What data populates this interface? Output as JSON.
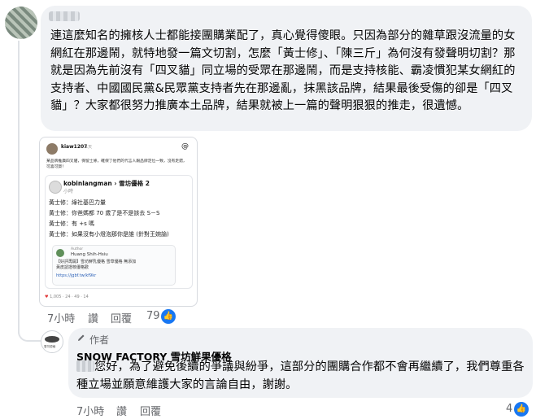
{
  "comment1": {
    "text": "連這麼知名的擁核人士都能接團購業配了，真心覺得傻眼。只因為部分的雜草跟沒流量的女網紅在那邊鬧，就特地發一篇文切割，怎麼「黃士修」、「陳三斤」為何沒有發聲明切割？那就是因為先前沒有「四叉貓」同立場的受眾在那邊鬧，而是支持核能、霸凌慣犯某女網紅的支持者、中國國民黨&民眾黨支持者先在那邊亂，抹黑該品牌，結果最後受傷的卻是「四叉貓」？大家都很努力推廣本土品牌，結果就被上一篇的聲明狠狠的推走，很遺憾。",
    "time": "7小時",
    "like_label": "讚",
    "reply_label": "回覆",
    "reaction_count": "79"
  },
  "screenshot": {
    "user": "kiaw1207",
    "user_time": "1天",
    "user_text": "某品牌推廣四叉貓，保留土條，確保了他們的代言人跟品牌定位一致，沒有走錯，可喜可賀！",
    "threads_logo": "@",
    "reply_name": "kobinlangman › 雪坊優格 2",
    "reply_time": "小時",
    "lines": [
      "黃士修：綠社基巴力量",
      "黃士修：你爸媽都 70 歲了是不是該去 S－S",
      "黃士修：有 +s 嗎",
      "黃士修：如果沒有小燈泡那你是誰 (針對王婉諭)"
    ],
    "card_author": "Author",
    "card_name": "Huang Shih-Hsiu",
    "card_text": "【好評再開】雪坊鮮乳優格 雪草優格 無添加 黃皮認證核優格歡",
    "card_link": "https://jgbf.tw/kf9kr",
    "stats": "1,005 · 24 · 49 · 14"
  },
  "comment2": {
    "author_label": "作者",
    "page_name": "SNOW FACTORY 雪坊鮮果優格",
    "avatar_text": "雪坊優格",
    "text": "您好，為了避免後續的爭議與紛爭，這部分的團購合作都不會再繼續了，我們尊重各種立場並願意維護大家的言論自由，謝謝。",
    "time": "7小時",
    "like_label": "讚",
    "reply_label": "回覆",
    "reaction_count": "4"
  }
}
